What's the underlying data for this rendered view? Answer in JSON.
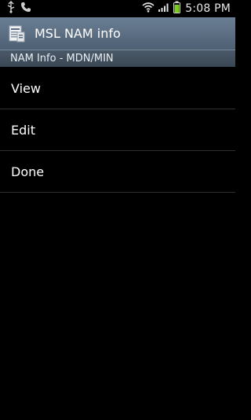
{
  "status_bar": {
    "time": "5:08 PM",
    "icons": [
      "usb-icon",
      "phone-icon",
      "wifi-icon",
      "signal-icon",
      "battery-icon"
    ]
  },
  "title_bar": {
    "title": "MSL NAM info",
    "icon": "app-icon"
  },
  "section_header": {
    "text": "NAM Info - MDN/MIN"
  },
  "menu": {
    "items": [
      {
        "label": "View"
      },
      {
        "label": "Edit"
      },
      {
        "label": "Done"
      }
    ]
  },
  "colors": {
    "title_bar": "#5d6f83",
    "section_header": "#414f5d",
    "background": "#000000",
    "battery": "#7acb1f"
  }
}
